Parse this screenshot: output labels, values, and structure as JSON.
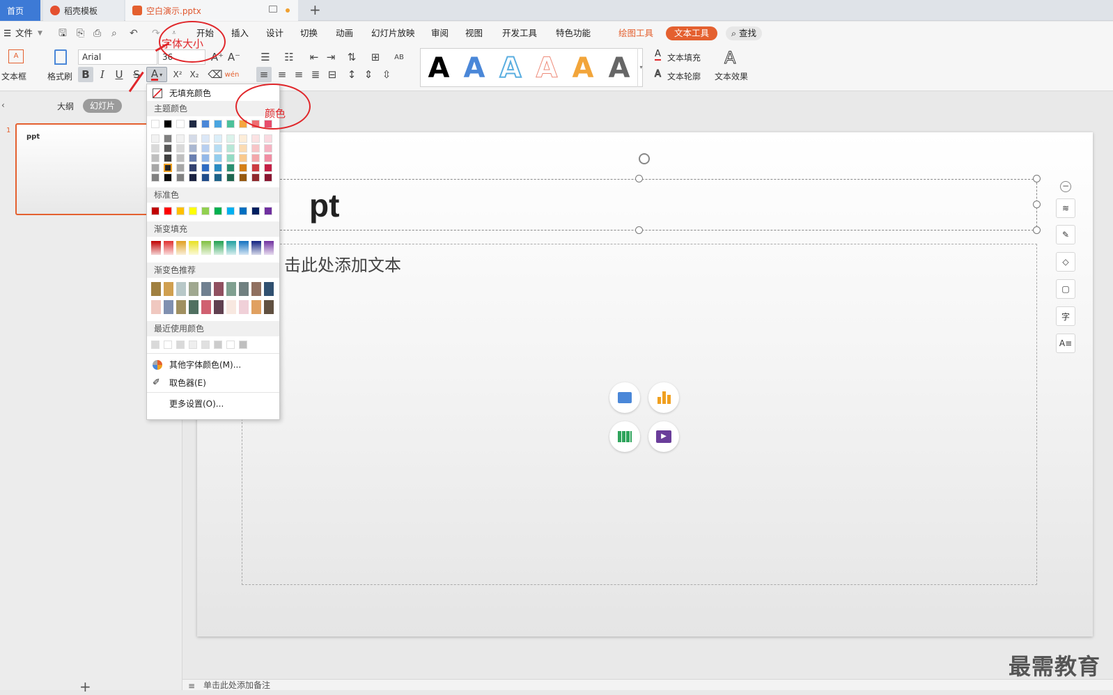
{
  "tabs": {
    "home": "首页",
    "template": "稻壳模板",
    "document": "空白演示.pptx",
    "new_tab": "+"
  },
  "menu": {
    "file": "文件",
    "items": [
      "开始",
      "插入",
      "设计",
      "切换",
      "动画",
      "幻灯片放映",
      "审阅",
      "视图",
      "开发工具",
      "特色功能"
    ],
    "drawing_tools": "绘图工具",
    "text_tools": "文本工具",
    "search": "查找"
  },
  "toolbar": {
    "textbox": "文本框",
    "format_painter": "格式刷",
    "font_name": "Arial",
    "font_size": "36",
    "bold": "B",
    "italic": "I",
    "underline": "U",
    "strike": "S",
    "text_fill": "文本填充",
    "text_outline": "文本轮廓",
    "text_effect": "文本效果",
    "wordart_colors": [
      "#000000",
      "#4a87d8",
      "#5aaee0",
      "#ee8a78",
      "#f2a53a",
      "#666666"
    ]
  },
  "left_panel": {
    "outline": "大纲",
    "slides": "幻灯片",
    "slide_number": "1",
    "thumb_text": "ppt",
    "add": "+"
  },
  "slide": {
    "title": "ppt",
    "body_placeholder": "单击此处添加文本",
    "title_visible": "pt",
    "body_visible": "击此处添加文本"
  },
  "dropdown": {
    "no_fill": "无填充颜色",
    "theme_colors": "主题颜色",
    "standard_colors": "标准色",
    "gradient_fill": "渐变填充",
    "gradient_recommend": "渐变色推荐",
    "recent_colors": "最近使用颜色",
    "more_colors": "其他字体颜色(M)...",
    "eyedropper": "取色器(E)",
    "more_settings": "更多设置(O)...",
    "theme_top": [
      "#ffffff",
      "#000000",
      "#ffffff",
      "#1f2a44",
      "#4a87d8",
      "#4aa6e0",
      "#4cc19a",
      "#f5a640",
      "#ee6e72",
      "#e84c6c"
    ],
    "theme_columns": [
      [
        "#f2f2f2",
        "#d9d9d9",
        "#bfbfbf",
        "#a6a6a6",
        "#808080"
      ],
      [
        "#808080",
        "#595959",
        "#404040",
        "#262626",
        "#0d0d0d"
      ],
      [
        "#f2f2f2",
        "#d9d9d9",
        "#bfbfbf",
        "#a6a6a6",
        "#808080"
      ],
      [
        "#d5dbe8",
        "#aab7d1",
        "#6a7fb0",
        "#334270",
        "#1a2140"
      ],
      [
        "#dbe7f7",
        "#b7cff0",
        "#93b8e8",
        "#2f6cc2",
        "#1f4c8a"
      ],
      [
        "#dbeef9",
        "#b6ddf3",
        "#92cded",
        "#2a8cc2",
        "#1d6389"
      ],
      [
        "#dbf3eb",
        "#b7e7d7",
        "#93dbc3",
        "#2a9070",
        "#1d664f"
      ],
      [
        "#fdedd9",
        "#fbdbb3",
        "#f9c98d",
        "#d47f16",
        "#96590f"
      ],
      [
        "#fbe2e3",
        "#f7c5c7",
        "#f3a8ab",
        "#cc3b40",
        "#90292d"
      ],
      [
        "#fad9e0",
        "#f5b3c2",
        "#f18da3",
        "#c41f45",
        "#8a1631"
      ]
    ],
    "standard": [
      "#c00000",
      "#ff0000",
      "#ffc000",
      "#ffff00",
      "#92d050",
      "#00b050",
      "#00b0f0",
      "#0070c0",
      "#002060",
      "#7030a0"
    ],
    "gradients": [
      "#c00000",
      "#e03030",
      "#e0a020",
      "#e8e020",
      "#80c040",
      "#20a050",
      "#20a0a0",
      "#1070c0",
      "#102080",
      "#7030a0"
    ],
    "recommend_row1": [
      "#a08040",
      "#d0a050",
      "#b8c8c8",
      "#a0a890",
      "#708090",
      "#905060",
      "#80a090",
      "#708080",
      "#907060",
      "#305070"
    ],
    "recommend_row2": [
      "#f0c8c0",
      "#8090b0",
      "#a09060",
      "#507060",
      "#d06070",
      "#604050",
      "#f8e8e0",
      "#f0d0d8",
      "#e0a060",
      "#605040"
    ],
    "recent": [
      "#d9d9d9",
      "#ffffff",
      "#d9d9d9",
      "#eeeeee",
      "#e0e0e0",
      "#cccccc",
      "#ffffff",
      "#bfbfbf"
    ]
  },
  "annotations": {
    "font_size_label": "字体大小",
    "color_label": "颜色"
  },
  "watermark": "最需教育",
  "notes_placeholder": "单击此处添加备注"
}
